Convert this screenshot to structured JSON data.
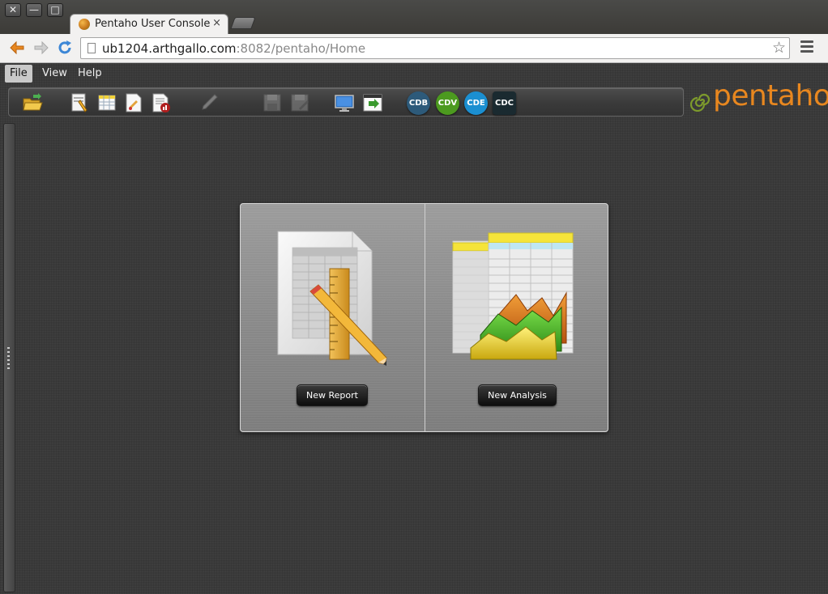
{
  "browser": {
    "tab_title": "Pentaho User Console",
    "tab_close": "×",
    "url_host": "ub1204.arthgallo.com",
    "url_path": ":8082/pentaho/Home",
    "window_buttons": {
      "close": "✕",
      "minimize": "—",
      "maximize": "□"
    }
  },
  "menu": {
    "items": [
      {
        "label": "File",
        "active": true
      },
      {
        "label": "View",
        "active": false
      },
      {
        "label": "Help",
        "active": false
      }
    ]
  },
  "toolbar": {
    "icons": [
      "open-folder-icon",
      "new-report-icon",
      "new-analysis-icon",
      "new-document-icon",
      "pdf-report-icon",
      "edit-pencil-icon",
      "save-icon",
      "save-as-icon",
      "monitor-icon",
      "browser-icon"
    ],
    "badges": [
      {
        "label": "CDB",
        "color": "#2d5a7a"
      },
      {
        "label": "CDV",
        "color": "#4c9a1f"
      },
      {
        "label": "CDE",
        "color": "#1b8fd1"
      },
      {
        "label": "CDC",
        "color": "#1a2a30"
      }
    ]
  },
  "logo": {
    "text": "pentaho",
    "tm": "®"
  },
  "launch": {
    "new_report_label": "New Report",
    "new_analysis_label": "New Analysis"
  },
  "colors": {
    "accent": "#e8871f",
    "background": "#3a3a3a"
  }
}
